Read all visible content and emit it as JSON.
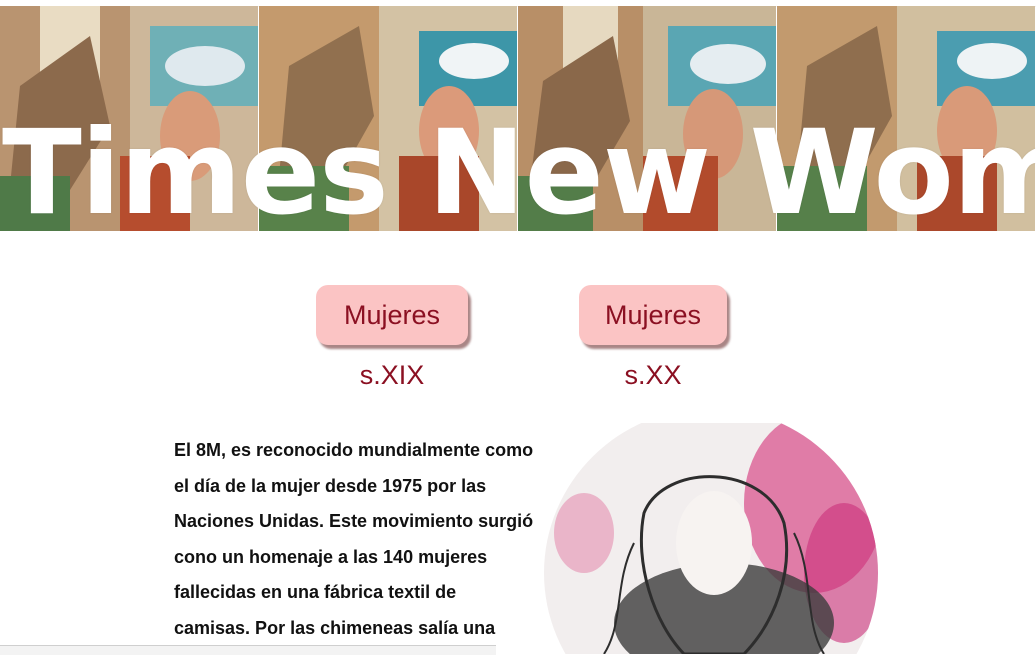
{
  "banner": {
    "title": "Times New Woman",
    "image_icon": "collage-woman-wolf-image"
  },
  "nav": {
    "btn_1": "Mujeres s.XIX",
    "btn_2": "Mujeres s.XX"
  },
  "article": {
    "lines": [
      "El 8M, es reconocido mundialmente como",
      "el día de la mujer desde 1975 por las",
      "Naciones Unidas. Este movimiento surgió",
      "cono un homenaje a las 140 mujeres",
      "fallecidas en una fábrica textil de",
      "camisas. Por las chimeneas salía una"
    ]
  },
  "colors": {
    "button_bg": "#fbc4c4",
    "button_text": "#8b1022",
    "button_shadow": "#a98686"
  }
}
